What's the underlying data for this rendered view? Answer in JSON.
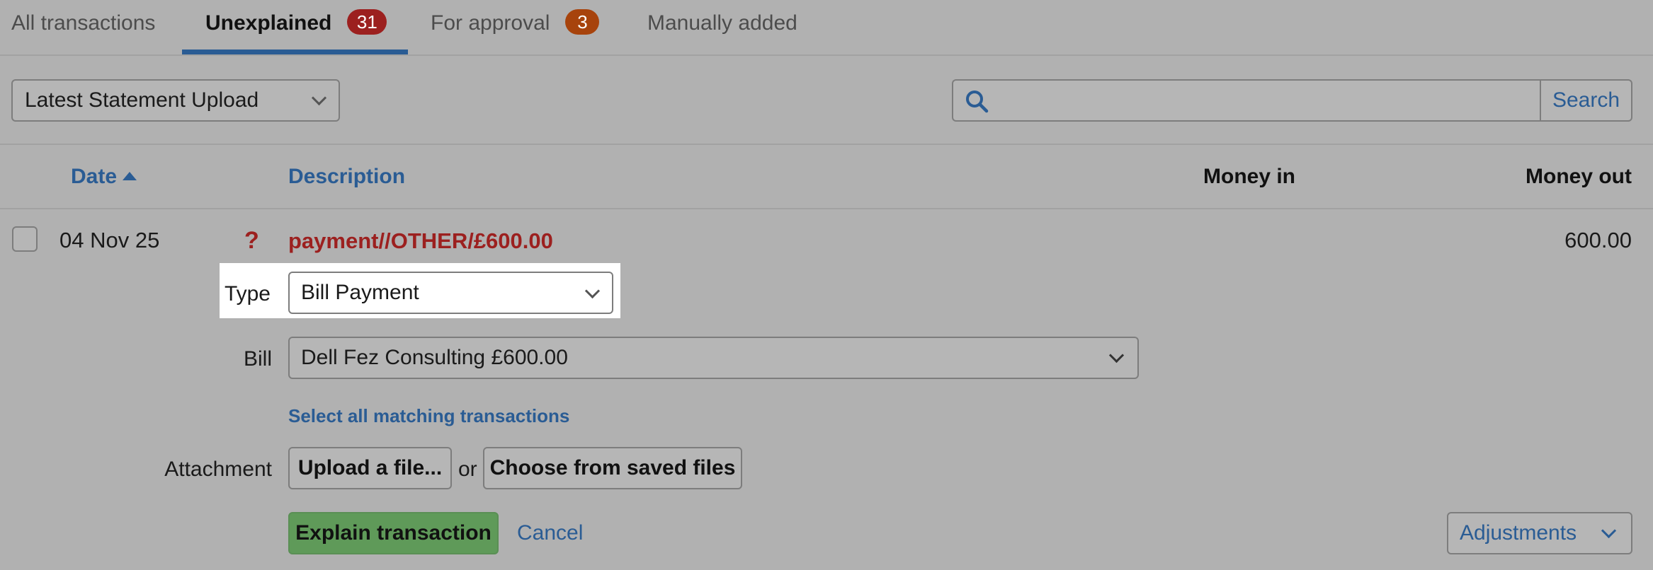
{
  "tabs": [
    {
      "label": "All transactions",
      "badge": null
    },
    {
      "label": "Unexplained",
      "badge": "31"
    },
    {
      "label": "For approval",
      "badge": "3"
    },
    {
      "label": "Manually added",
      "badge": null
    }
  ],
  "filters": {
    "statement_select": "Latest Statement Upload",
    "search_placeholder": "",
    "search_button": "Search",
    "search_icon": "search-icon"
  },
  "table": {
    "columns": {
      "date": "Date",
      "description": "Description",
      "money_in": "Money in",
      "money_out": "Money out"
    },
    "row": {
      "date": "04 Nov 25",
      "status_icon": "?",
      "description": "payment//OTHER/£600.00",
      "money_in": "",
      "money_out": "600.00"
    }
  },
  "explain_form": {
    "type_label": "Type",
    "type_value": "Bill Payment",
    "bill_label": "Bill",
    "bill_value": "Dell Fez Consulting £600.00",
    "select_all_link": "Select all matching transactions",
    "attachment_label": "Attachment",
    "upload_button": "Upload a file...",
    "or_text": "or",
    "saved_files_button": "Choose from saved files",
    "explain_button": "Explain transaction",
    "cancel_link": "Cancel",
    "adjustments_button": "Adjustments"
  },
  "colors": {
    "background": "#b1b1b1",
    "link_blue": "#2a5c94",
    "alert_red": "#9c201f",
    "badge_brown": "#a7430c",
    "explain_green": "#5f9a59",
    "highlight": "#ffffff"
  }
}
